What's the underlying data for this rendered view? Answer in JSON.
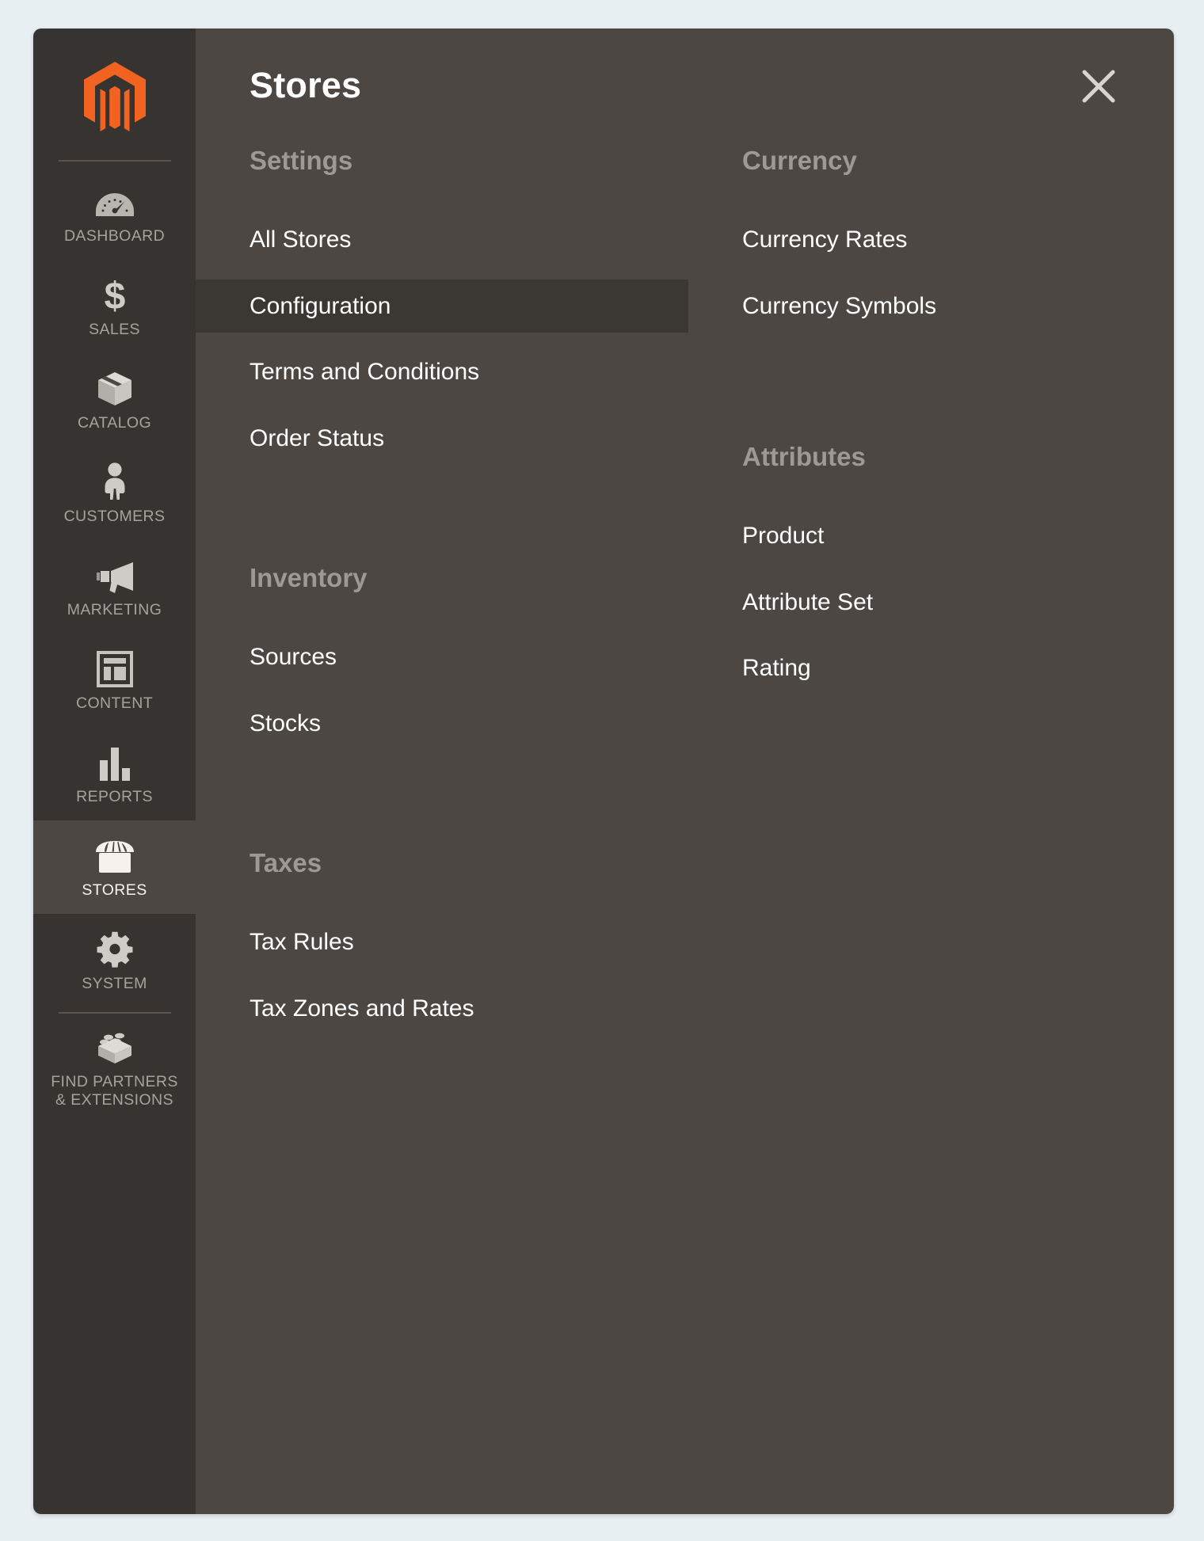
{
  "sidebar": {
    "logo_name": "magento-logo",
    "brand_color": "#f26322",
    "items": [
      {
        "label": "DASHBOARD",
        "icon": "dashboard-gauge-icon",
        "active": false
      },
      {
        "label": "SALES",
        "icon": "dollar-sign-icon",
        "active": false
      },
      {
        "label": "CATALOG",
        "icon": "box-icon",
        "active": false
      },
      {
        "label": "CUSTOMERS",
        "icon": "person-icon",
        "active": false
      },
      {
        "label": "MARKETING",
        "icon": "megaphone-icon",
        "active": false
      },
      {
        "label": "CONTENT",
        "icon": "page-layout-icon",
        "active": false
      },
      {
        "label": "REPORTS",
        "icon": "bar-chart-icon",
        "active": false
      },
      {
        "label": "STORES",
        "icon": "storefront-icon",
        "active": true
      },
      {
        "label": "SYSTEM",
        "icon": "gear-icon",
        "active": false
      },
      {
        "label": "FIND PARTNERS\n& EXTENSIONS",
        "label_line1": "FIND PARTNERS",
        "label_line2": "& EXTENSIONS",
        "icon": "lego-brick-icon",
        "active": false
      }
    ]
  },
  "panel": {
    "title": "Stores",
    "close_label": "close-icon",
    "columns": {
      "left": [
        {
          "title": "Settings",
          "links": [
            {
              "label": "All Stores",
              "selected": false
            },
            {
              "label": "Configuration",
              "selected": true
            },
            {
              "label": "Terms and Conditions",
              "selected": false
            },
            {
              "label": "Order Status",
              "selected": false
            }
          ]
        },
        {
          "title": "Inventory",
          "links": [
            {
              "label": "Sources",
              "selected": false
            },
            {
              "label": "Stocks",
              "selected": false
            }
          ]
        },
        {
          "title": "Taxes",
          "links": [
            {
              "label": "Tax Rules",
              "selected": false
            },
            {
              "label": "Tax Zones and Rates",
              "selected": false
            }
          ]
        }
      ],
      "right": [
        {
          "title": "Currency",
          "links": [
            {
              "label": "Currency Rates",
              "selected": false
            },
            {
              "label": "Currency Symbols",
              "selected": false
            }
          ]
        },
        {
          "title": "Attributes",
          "links": [
            {
              "label": "Product",
              "selected": false
            },
            {
              "label": "Attribute Set",
              "selected": false
            },
            {
              "label": "Rating",
              "selected": false
            }
          ]
        }
      ]
    }
  },
  "colors": {
    "page_background": "#e8eff3",
    "sidebar_background": "#373330",
    "panel_background": "#4c4743",
    "selected_background": "#3b3733",
    "active_nav_background": "#4c4743",
    "group_title_color": "#9e9993",
    "link_color": "#ffffff",
    "nav_label_color": "#a6a29d"
  }
}
